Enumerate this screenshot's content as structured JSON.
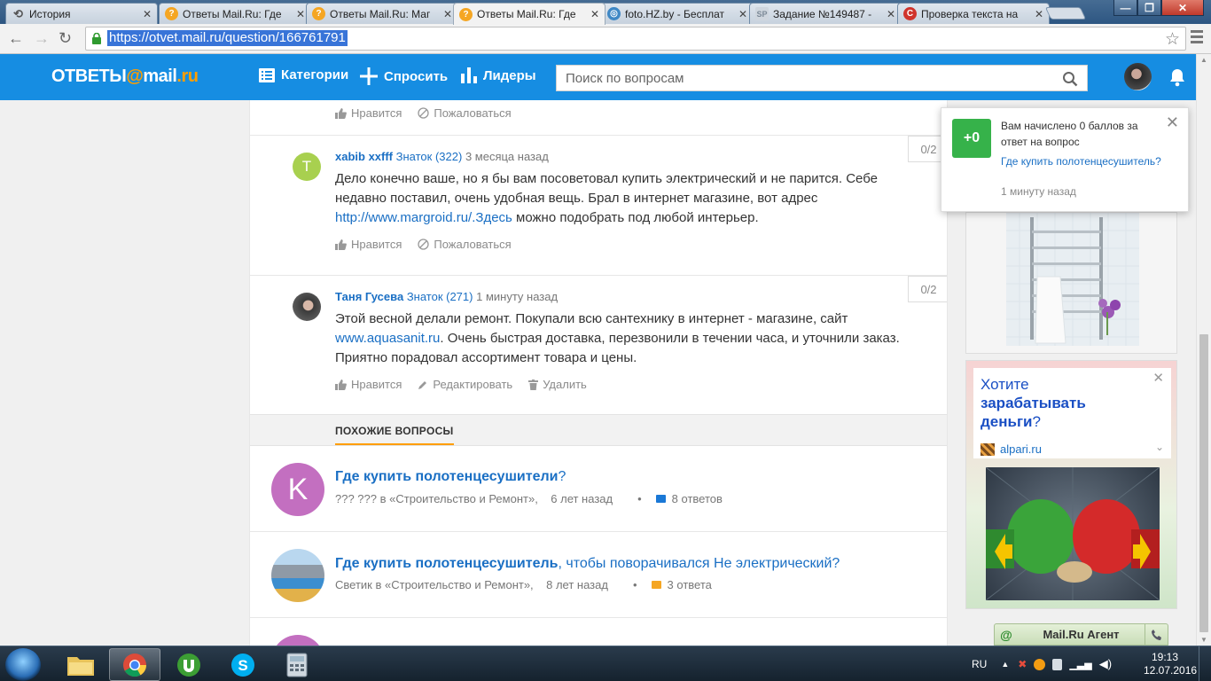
{
  "browser": {
    "tabs": [
      {
        "title": "История",
        "icon": "history-icon",
        "active": false
      },
      {
        "title": "Ответы Mail.Ru: Где",
        "icon": "question-icon",
        "active": false
      },
      {
        "title": "Ответы Mail.Ru: Маг",
        "icon": "question-icon",
        "active": false
      },
      {
        "title": "Ответы Mail.Ru: Где",
        "icon": "question-icon",
        "active": true
      },
      {
        "title": "foto.HZ.by - Бесплат",
        "icon": "globe-icon",
        "active": false
      },
      {
        "title": "Задание №149487 -",
        "icon": "sp-icon",
        "active": false
      },
      {
        "title": "Проверка текста на",
        "icon": "copyright-icon",
        "active": false
      }
    ],
    "url": "https://otvet.mail.ru/question/166761791"
  },
  "header": {
    "logo_text": "ОТВЕТЫ",
    "logo_at": "@",
    "logo_mail": "mail",
    "logo_ru": ".ru",
    "nav_categories": "Категории",
    "nav_ask": "Спросить",
    "nav_leaders": "Лидеры",
    "search_placeholder": "Поиск по вопросам"
  },
  "prev_answer_actions": {
    "like": "Нравится",
    "report": "Пожаловаться"
  },
  "answers": [
    {
      "avatar_letter": "T",
      "avatar_color": "#a8d04f",
      "name": "xabib xxfff",
      "rank": "Знаток (322)",
      "time": "3 месяца назад",
      "score": "0/2",
      "text_1": "Дело конечно ваше, но я бы вам посоветовал купить электрический и не парится. Себе недавно поставил, очень удобная вещь. Брал в интернет магазине, вот адрес ",
      "link": "http://www.margroid.ru/.Здесь",
      "text_2": " можно подобрать под любой интерьер.",
      "like": "Нравится",
      "report": "Пожаловаться"
    },
    {
      "name": "Таня Гусева",
      "rank": "Знаток (271)",
      "time": "1 минуту назад",
      "score": "0/2",
      "text_1": "Этой весной делали ремонт. Покупали всю сантехнику в интернет - магазине, сайт ",
      "link": "www.aquasanit.ru",
      "text_2": ". Очень быстрая доставка, перезвонили в течении часа, и уточнили заказ. Приятно порадовал ассортимент товара и цены.",
      "like": "Нравится",
      "edit": "Редактировать",
      "delete": "Удалить"
    }
  ],
  "similar": {
    "heading": "ПОХОЖИЕ ВОПРОСЫ",
    "items": [
      {
        "avatar_letter": "K",
        "avatar_color": "#c36fc0",
        "title_bold": "Где купить полотенцесушители",
        "title_rest": "?",
        "author": "??? ???",
        "category": "в «Строительство и Ремонт»,",
        "age": "6 лет назад",
        "dot": "•",
        "answers": "8 ответов",
        "count_color": "#1a78d6"
      },
      {
        "title_bold": "Где купить полотенцесушитель",
        "title_rest": ", чтобы поворачивался Не электрический?",
        "author": "Светик",
        "category": "в «Строительство и Ремонт»,",
        "age": "8 лет назад",
        "dot": "•",
        "answers": "3 ответа",
        "count_color": "#f5a623"
      }
    ]
  },
  "notification": {
    "badge": "+0",
    "text": "Вам начислено 0 баллов за ответ на вопрос",
    "link": "Где купить полотенцесушитель?",
    "time": "1 минуту назад"
  },
  "ad": {
    "title_line1": "Хотите",
    "title_line2": "зарабатывать",
    "title_line3": "деньги",
    "title_q": "?",
    "site": "alpari.ru"
  },
  "agent": {
    "label": "Mail.Ru Агент",
    "at": "@"
  },
  "taskbar": {
    "lang": "RU",
    "time": "19:13",
    "date": "12.07.2016"
  }
}
